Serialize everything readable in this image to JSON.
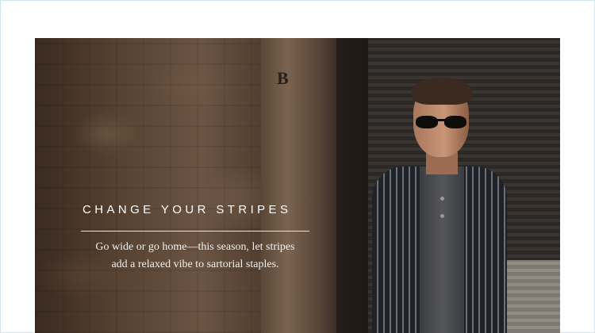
{
  "feature": {
    "headline": "CHANGE YOUR STRIPES",
    "blurb": "Go wide or go home—this season, let stripes add a relaxed vibe to sartorial staples."
  },
  "photo": {
    "pillar_letter": "B"
  }
}
